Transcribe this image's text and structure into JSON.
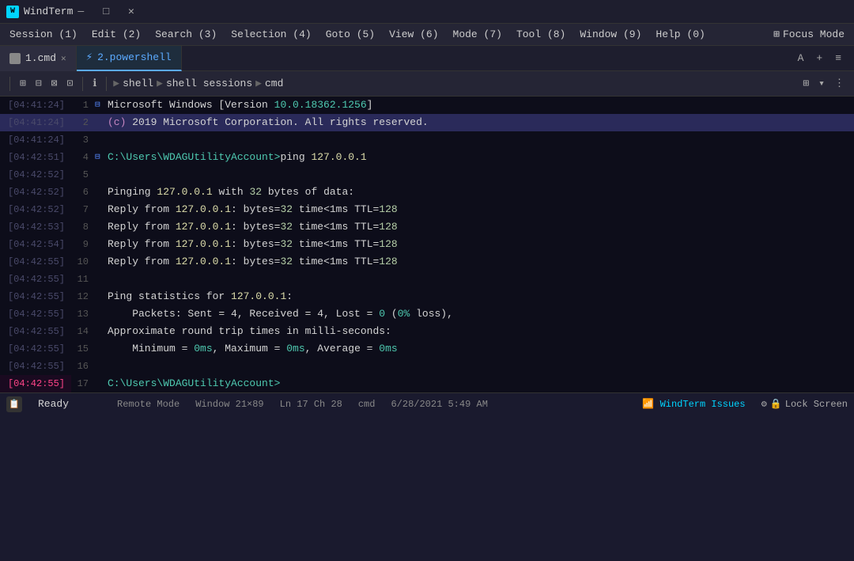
{
  "titlebar": {
    "icon_text": "W",
    "title": "WindTerm",
    "btn_minimize": "—",
    "btn_maximize": "□",
    "btn_close": "✕"
  },
  "menubar": {
    "items": [
      {
        "label": "Session (1)"
      },
      {
        "label": "Edit (2)"
      },
      {
        "label": "Search (3)"
      },
      {
        "label": "Selection (4)"
      },
      {
        "label": "Goto (5)"
      },
      {
        "label": "View (6)"
      },
      {
        "label": "Mode (7)"
      },
      {
        "label": "Tool (8)"
      },
      {
        "label": "Window (9)"
      },
      {
        "label": "Help (0)"
      }
    ],
    "focus_mode": "Focus Mode"
  },
  "tabs": [
    {
      "id": "cmd",
      "label": "1.cmd",
      "active": false
    },
    {
      "id": "ps",
      "label": "2.powershell",
      "active": true
    }
  ],
  "tab_actions": {
    "font": "A",
    "add": "+",
    "menu": "≡"
  },
  "toolbar": {
    "breadcrumb": [
      "shell",
      "shell sessions",
      "cmd"
    ]
  },
  "terminal": {
    "lines": [
      {
        "time": "[04:41:24]",
        "num": 1,
        "marker": "⊟",
        "content": "Microsoft Windows [Version ",
        "version": "10.0.18362.1256",
        "suffix": "]",
        "selected": false
      },
      {
        "time": "[04:41:24]",
        "num": 2,
        "marker": "",
        "content": "",
        "selected": true,
        "raw": "(c) 2019 Microsoft Corporation. All rights reserved."
      },
      {
        "time": "[04:41:24]",
        "num": 3,
        "marker": "",
        "content": "",
        "selected": false,
        "raw": ""
      },
      {
        "time": "[04:42:51]",
        "num": 4,
        "marker": "⊟",
        "content": "C:\\Users\\WDAGUtilityAccount>ping ",
        "ip": "127.0.0.1",
        "selected": false
      },
      {
        "time": "[04:42:52]",
        "num": 5,
        "marker": "",
        "content": "",
        "selected": false,
        "raw": ""
      },
      {
        "time": "[04:42:52]",
        "num": 6,
        "marker": "",
        "content": "Pinging ",
        "ip": "127.0.0.1",
        "suffix": " with ",
        "num2": "32",
        "suffix2": " bytes of data:",
        "selected": false
      },
      {
        "time": "[04:42:52]",
        "num": 7,
        "marker": "",
        "content": "Reply from ",
        "ip": "127.0.0.1",
        "suffix": ": bytes=",
        "num2": "32",
        "suffix2": " time<1ms TTL=",
        "num3": "128",
        "selected": false
      },
      {
        "time": "[04:42:53]",
        "num": 8,
        "marker": "",
        "content": "Reply from ",
        "ip": "127.0.0.1",
        "suffix": ": bytes=",
        "num2": "32",
        "suffix2": " time<1ms TTL=",
        "num3": "128",
        "selected": false
      },
      {
        "time": "[04:42:54]",
        "num": 9,
        "marker": "",
        "content": "Reply from ",
        "ip": "127.0.0.1",
        "suffix": ": bytes=",
        "num2": "32",
        "suffix2": " time<1ms TTL=",
        "num3": "128",
        "selected": false
      },
      {
        "time": "[04:42:55]",
        "num": 10,
        "marker": "",
        "content": "Reply from ",
        "ip": "127.0.0.1",
        "suffix": ": bytes=",
        "num2": "32",
        "suffix2": " time<1ms TTL=",
        "num3": "128",
        "selected": false
      },
      {
        "time": "[04:42:55]",
        "num": 11,
        "marker": "",
        "content": "",
        "selected": false,
        "raw": ""
      },
      {
        "time": "[04:42:55]",
        "num": 12,
        "marker": "",
        "content": "Ping statistics for ",
        "ip": "127.0.0.1",
        "suffix": ":",
        "selected": false
      },
      {
        "time": "[04:42:55]",
        "num": 13,
        "marker": "",
        "content": "    Packets: Sent = 4, Received = 4, Lost = ",
        "zero": "0",
        "suffix": " (",
        "zeropct": "0%",
        "suffix2": " loss),",
        "selected": false
      },
      {
        "time": "[04:42:55]",
        "num": 14,
        "marker": "",
        "content": "Approximate round trip times in milli-seconds:",
        "selected": false
      },
      {
        "time": "[04:42:55]",
        "num": 15,
        "marker": "",
        "content": "    Minimum = ",
        "z1": "0ms",
        "suffix": ", Maximum = ",
        "z2": "0ms",
        "suffix2": ", Average = ",
        "z3": "0ms",
        "selected": false
      },
      {
        "time": "[04:42:55]",
        "num": 16,
        "marker": "",
        "content": "",
        "selected": false,
        "raw": ""
      },
      {
        "time": "[04:42:55]",
        "num": 17,
        "marker": "",
        "content": "C:\\Users\\WDAGUtilityAccount>",
        "selected": false,
        "active_time": true
      }
    ]
  },
  "statusbar": {
    "ready": "Ready",
    "remote_mode": "Remote Mode",
    "window_size": "Window 21×89",
    "position": "Ln 17 Ch 28",
    "shell": "cmd",
    "datetime": "6/28/2021  5:49 AM",
    "issues": "WindTerm Issues",
    "lock": "Lock Screen",
    "settings_icon": "⚙"
  }
}
